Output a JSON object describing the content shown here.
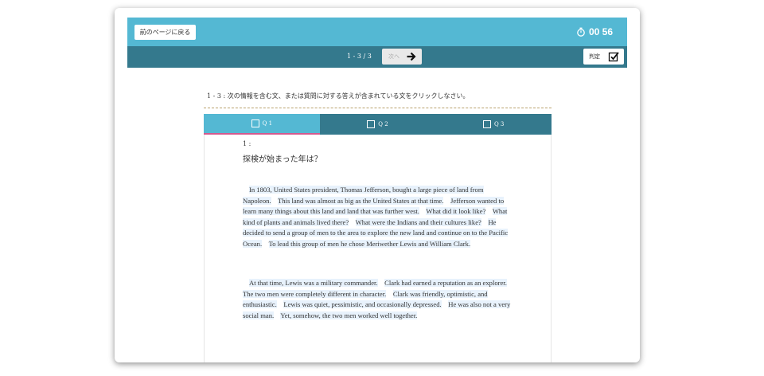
{
  "header": {
    "back_label": "前のページに戻る",
    "timer": "00 56"
  },
  "nav": {
    "page_indicator": "1 - 3 / 3",
    "next_label": "次へ",
    "judge_label": "判定"
  },
  "instruction": {
    "number": "1 - 3 :",
    "text": "次の情報を含む文、または質問に対する答えが含まれている文をクリックしなさい。"
  },
  "tabs": [
    {
      "label": "Q 1",
      "active": true
    },
    {
      "label": "Q 2",
      "active": false
    },
    {
      "label": "Q 3",
      "active": false
    }
  ],
  "question": {
    "number": "1 :",
    "text": "探検が始まった年は？"
  },
  "passage": {
    "paragraphs": [
      [
        "In 1803, United States president, Thomas Jefferson, bought a large piece of land from Napoleon.",
        "This land was almost as big as the United States at that time.",
        "Jefferson wanted to learn many things about this land and land that was further west.",
        "What did it look like?",
        "What kind of plants and animals lived there?",
        "What were the Indians and their cultures like?",
        "He decided to send a group of men to the area to explore the new land and continue on to the Pacific Ocean.",
        "To lead this group of men he chose Meriwether Lewis and William Clark."
      ],
      [
        "At that time, Lewis was a military commander.",
        "Clark had earned a reputation as an explorer.",
        "The two men were completely different in character.",
        "Clark was friendly, optimistic, and enthusiastic.",
        "Lewis was quiet, pessimistic, and occasionally depressed.",
        "He was also not a very social man.",
        "Yet, somehow, the two men worked well together."
      ]
    ]
  },
  "colors": {
    "topbar": "#54b8d3",
    "navbar": "#34798d",
    "active_tab_underline": "#d4598e",
    "sentence_highlight": "#e8f2fc"
  }
}
